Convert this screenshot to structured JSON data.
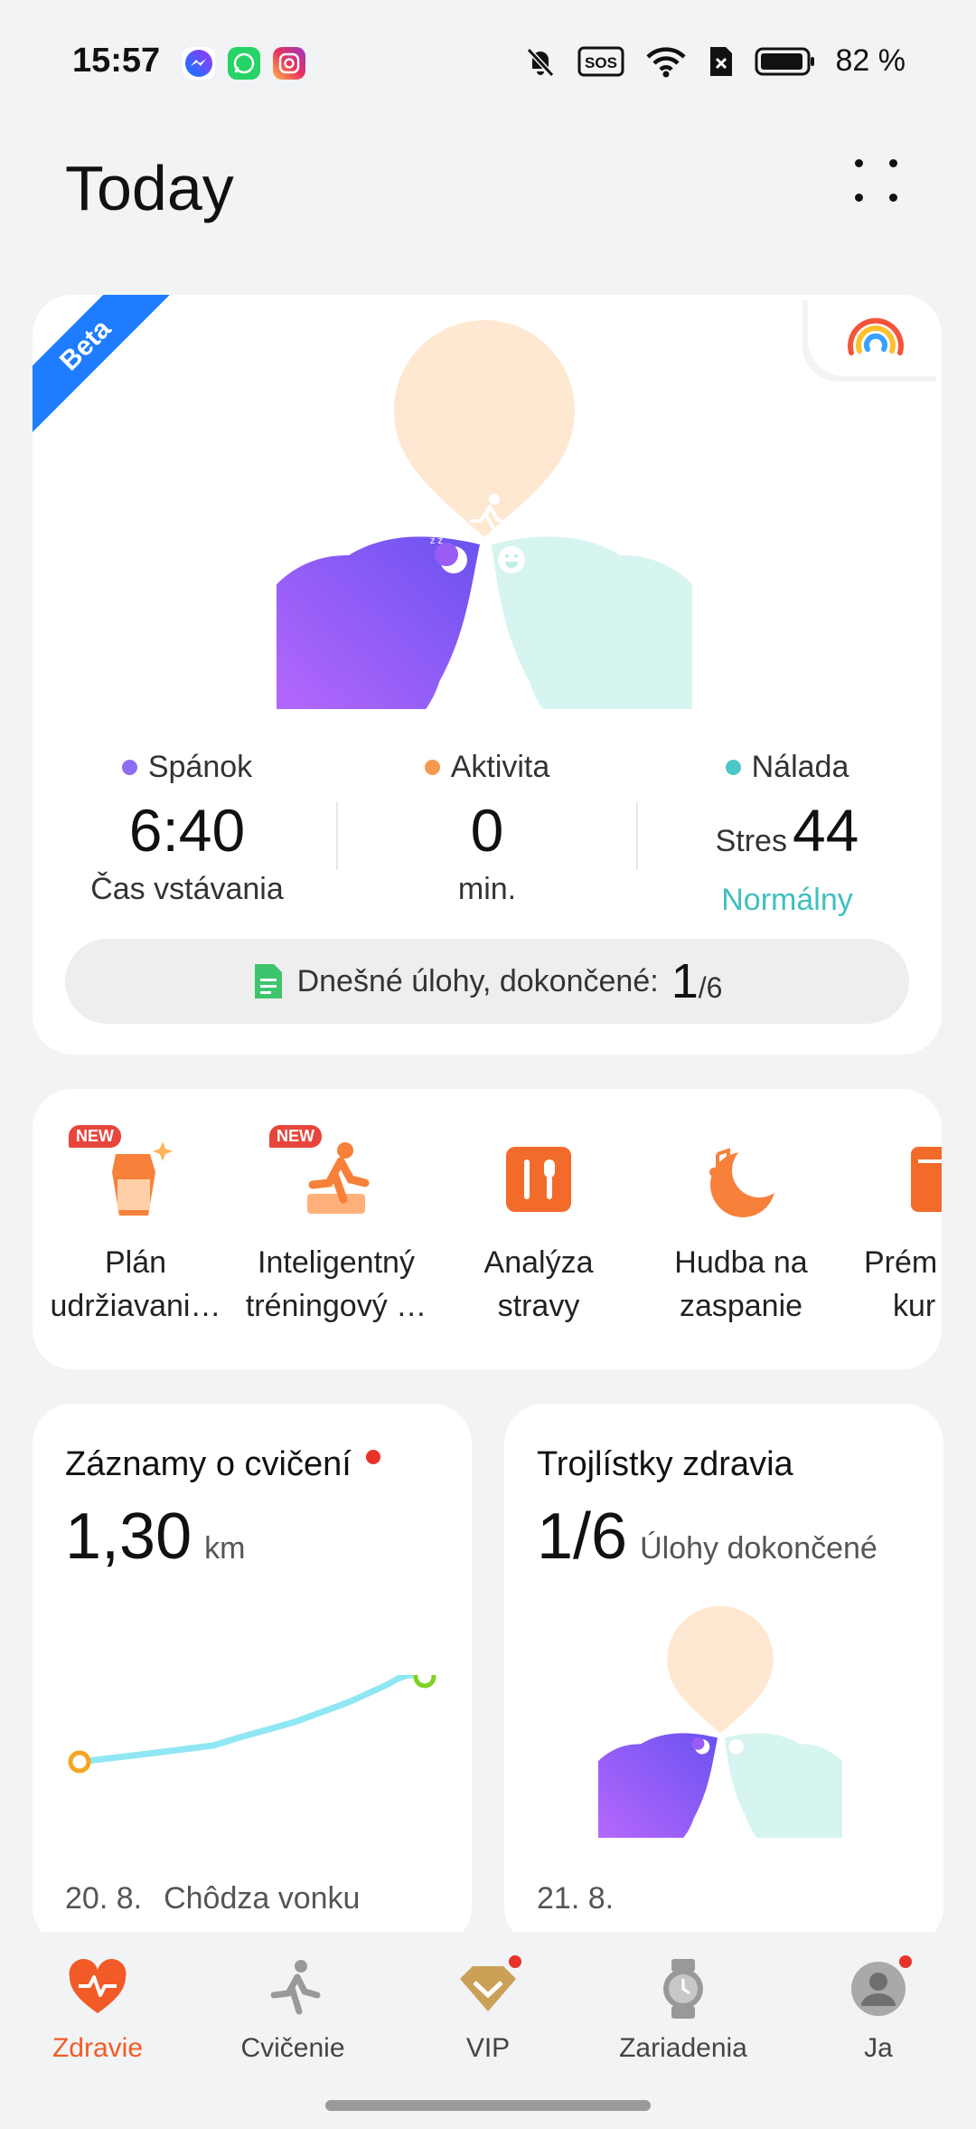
{
  "status_bar": {
    "time": "15:57",
    "battery_pct": "82 %",
    "notification_apps": [
      "messenger-icon",
      "whatsapp-icon",
      "instagram-icon"
    ],
    "indicators": [
      "mute-icon",
      "sos-icon",
      "wifi-icon",
      "no-sim-icon",
      "battery-icon"
    ]
  },
  "header": {
    "title": "Today"
  },
  "hero": {
    "badge": "Beta",
    "stats": [
      {
        "label": "Spánok",
        "value": "6:40",
        "sub": "Čas vstávania",
        "dot_color": "#8c6cf0"
      },
      {
        "label": "Aktivita",
        "value": "0",
        "sub": "min.",
        "dot_color": "#f59a4e"
      },
      {
        "label": "Nálada",
        "prefix": "Stres",
        "value": "44",
        "sub": "Normálny",
        "dot_color": "#4cc7c7",
        "sub_color": "#3fbfbf"
      }
    ],
    "tasks": {
      "label": "Dnešné úlohy, dokončené:",
      "done": "1",
      "total": "/6"
    }
  },
  "shortcuts": [
    {
      "label1": "Plán",
      "label2": "udržiavani…",
      "new": "NEW",
      "icon": "body-plan-icon"
    },
    {
      "label1": "Inteligentný",
      "label2": "tréningový …",
      "new": "NEW",
      "icon": "running-training-icon"
    },
    {
      "label1": "Analýza",
      "label2": "stravy",
      "icon": "fork-knife-icon"
    },
    {
      "label1": "Hudba na",
      "label2": "zaspanie",
      "icon": "sleep-music-icon"
    },
    {
      "label1": "Prém",
      "label2": "kur",
      "icon": "premium-course-icon"
    }
  ],
  "exercise_card": {
    "title": "Záznamy o cvičení",
    "value": "1,30",
    "unit": "km",
    "date": "20. 8.",
    "activity": "Chôdza vonku"
  },
  "trilobe_card": {
    "title": "Trojlístky zdravia",
    "value": "1/6",
    "unit": "Úlohy dokončené",
    "date": "21. 8."
  },
  "nav": [
    {
      "label": "Zdravie",
      "active": true
    },
    {
      "label": "Cvičenie"
    },
    {
      "label": "VIP",
      "badge": true
    },
    {
      "label": "Zariadenia"
    },
    {
      "label": "Ja",
      "badge": true
    }
  ],
  "colors": {
    "accent": "#f25b27",
    "sleep": "#8c6cf0",
    "activity": "#ffe8d2",
    "mood": "#d6f4f0",
    "beta": "#1e7cff"
  }
}
